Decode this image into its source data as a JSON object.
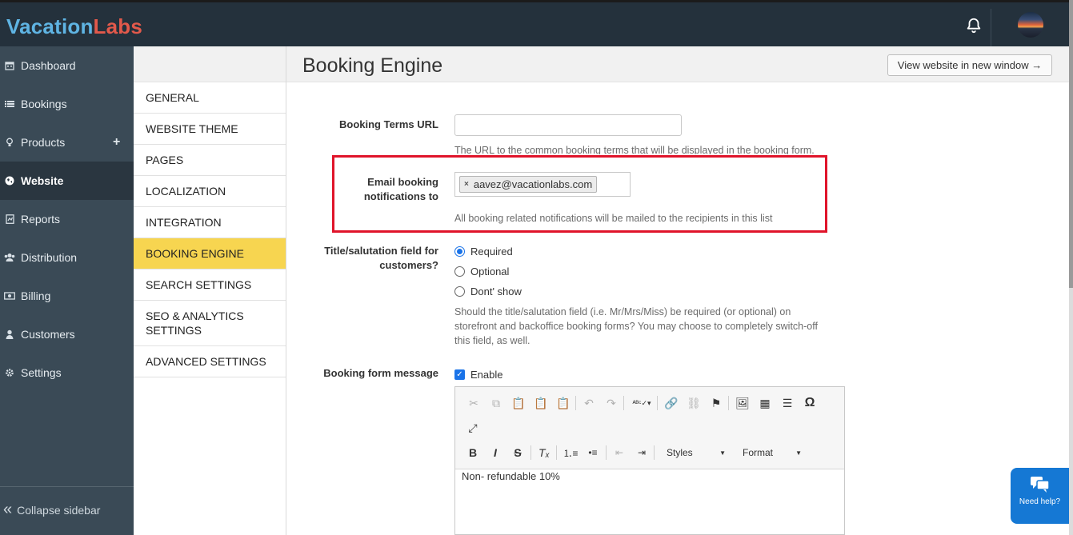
{
  "brand": {
    "part1": "Vacation",
    "part2": "Labs"
  },
  "header": {
    "notifications_icon": "bell-icon",
    "avatar": "user-avatar"
  },
  "nav": {
    "items": [
      {
        "label": "Dashboard",
        "icon": "calendar-icon"
      },
      {
        "label": "Bookings",
        "icon": "list-icon"
      },
      {
        "label": "Products",
        "icon": "lightbulb-icon",
        "extra": "+"
      },
      {
        "label": "Website",
        "icon": "globe-icon",
        "active": true
      },
      {
        "label": "Reports",
        "icon": "report-icon"
      },
      {
        "label": "Distribution",
        "icon": "users-icon"
      },
      {
        "label": "Billing",
        "icon": "money-icon"
      },
      {
        "label": "Customers",
        "icon": "user-icon"
      },
      {
        "label": "Settings",
        "icon": "gear-icon"
      }
    ],
    "collapse_label": "Collapse sidebar"
  },
  "submenu": {
    "items": [
      "GENERAL",
      "WEBSITE THEME",
      "PAGES",
      "LOCALIZATION",
      "INTEGRATION",
      "BOOKING ENGINE",
      "SEARCH SETTINGS",
      "SEO & ANALYTICS SETTINGS",
      "ADVANCED SETTINGS"
    ],
    "active": "BOOKING ENGINE"
  },
  "page": {
    "title": "Booking Engine",
    "view_button": "View website in new window →"
  },
  "form": {
    "terms_url": {
      "label": "Booking Terms URL",
      "value": "",
      "help": "The URL to the common booking terms that will be displayed in the booking form."
    },
    "email_notifications": {
      "label_line1": "Email booking",
      "label_line2": "notifications to",
      "tag": "aavez@vacationlabs.com",
      "tag_remove": "×",
      "help": "All booking related notifications will be mailed to the recipients in this list"
    },
    "salutation": {
      "label_line1": "Title/salutation field for",
      "label_line2": "customers?",
      "options": [
        "Required",
        "Optional",
        "Dont' show"
      ],
      "selected": "Required",
      "help_line1": "Should the title/salutation field (i.e. Mr/Mrs/Miss) be required (or optional) on",
      "help_line2": "storefront and backoffice booking forms? You may choose to completely switch-off",
      "help_line3": "this field, as well."
    },
    "booking_message": {
      "label": "Booking form message",
      "enable_label": "Enable",
      "enabled": true,
      "styles_label": "Styles",
      "format_label": "Format",
      "content": "Non- refundable 10%"
    }
  },
  "help_widget": {
    "label": "Need help?"
  }
}
